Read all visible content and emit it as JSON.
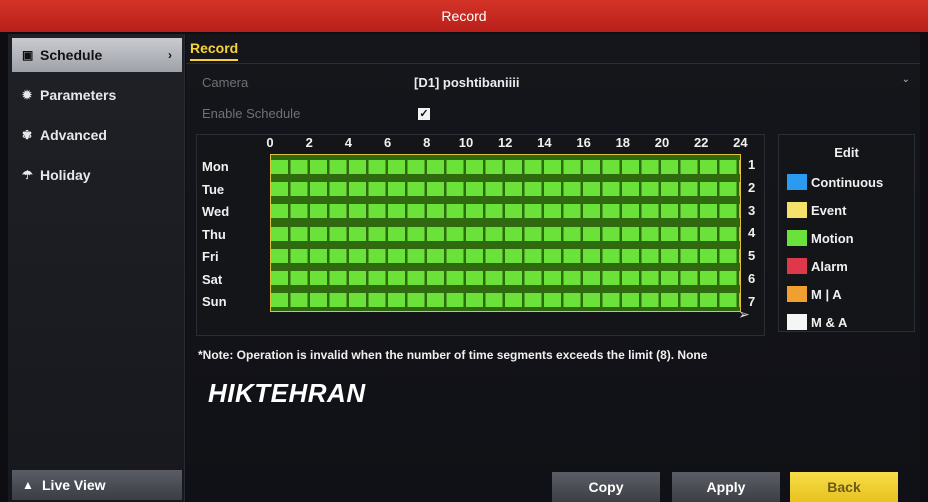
{
  "window": {
    "title": "Record"
  },
  "sidebar": {
    "items": [
      {
        "label": "Schedule",
        "icon": "schedule-icon",
        "active": true
      },
      {
        "label": "Parameters",
        "icon": "gear-icon",
        "active": false
      },
      {
        "label": "Advanced",
        "icon": "advanced-gear-icon",
        "active": false
      },
      {
        "label": "Holiday",
        "icon": "holiday-icon",
        "active": false
      }
    ],
    "live_view_label": "Live View"
  },
  "tab": {
    "label": "Record"
  },
  "form": {
    "camera_label": "Camera",
    "camera_value": "[D1] poshtibaniiii",
    "enable_schedule_label": "Enable Schedule",
    "enable_schedule_checked": true
  },
  "schedule": {
    "hours": [
      "0",
      "2",
      "4",
      "6",
      "8",
      "10",
      "12",
      "14",
      "16",
      "18",
      "20",
      "22",
      "24"
    ],
    "days": [
      "Mon",
      "Tue",
      "Wed",
      "Thu",
      "Fri",
      "Sat",
      "Sun"
    ],
    "row_numbers": [
      "1",
      "2",
      "3",
      "4",
      "5",
      "6",
      "7"
    ],
    "mode_all_days": "Motion"
  },
  "edit": {
    "title": "Edit",
    "legend": [
      {
        "label": "Continuous",
        "color": "#2b9bf0"
      },
      {
        "label": "Event",
        "color": "#f5e06a"
      },
      {
        "label": "Motion",
        "color": "#6be23a"
      },
      {
        "label": "Alarm",
        "color": "#e0384b"
      },
      {
        "label": "M | A",
        "color": "#f0a030"
      },
      {
        "label": "M & A",
        "color": "#f5f5f5"
      }
    ]
  },
  "note": "*Note: Operation is invalid when the number of time segments exceeds the limit (8). None",
  "brand": "HIKTEHRAN",
  "buttons": {
    "copy": "Copy",
    "apply": "Apply",
    "back": "Back"
  }
}
